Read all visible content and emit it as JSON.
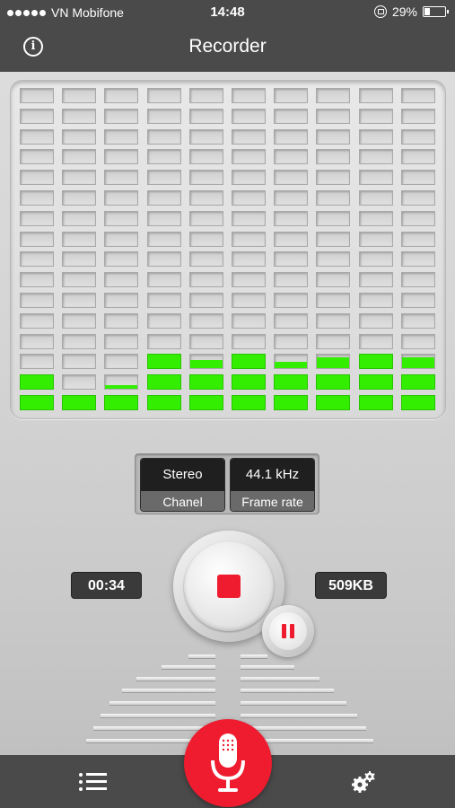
{
  "status_bar": {
    "carrier": "VN Mobifone",
    "time": "14:48",
    "battery_percent": "29%",
    "battery_level": 0.29
  },
  "header": {
    "title": "Recorder"
  },
  "equalizer": {
    "levels": [
      2,
      1,
      1.3,
      3,
      2.6,
      3,
      2.5,
      2.8,
      3,
      2.8
    ],
    "total_rows": 16,
    "active_color": "#33ee00"
  },
  "audio_info": {
    "channel_value": "Stereo",
    "channel_label": "Chanel",
    "rate_value": "44.1 kHz",
    "rate_label": "Frame rate"
  },
  "recording": {
    "elapsed": "00:34",
    "file_size": "509KB"
  },
  "colors": {
    "accent": "#ee1c2e",
    "bar": "#4a4a4a"
  }
}
